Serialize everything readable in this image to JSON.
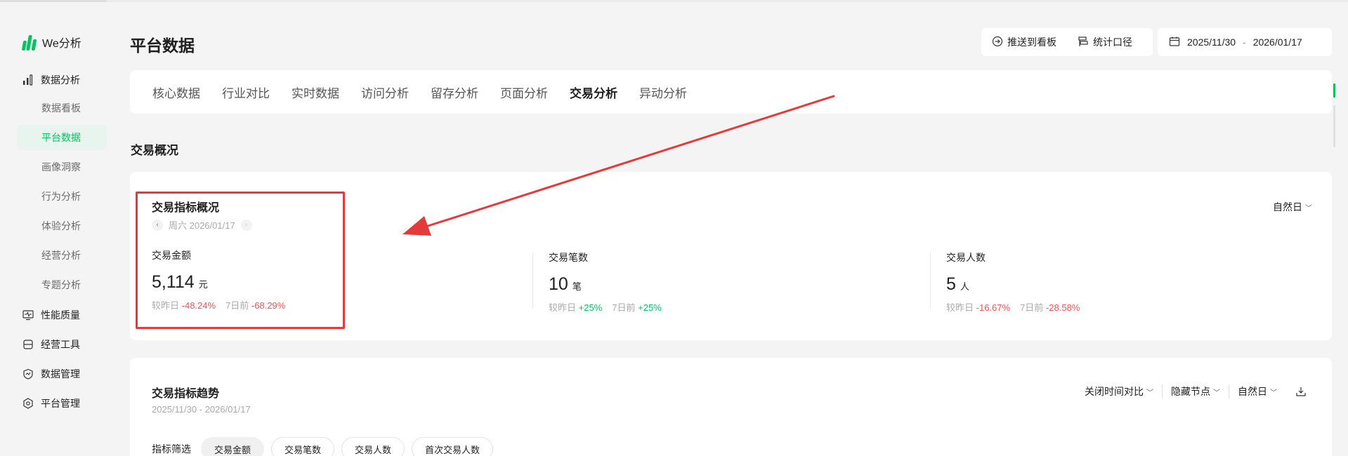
{
  "brand": {
    "name": "We分析",
    "color": "#07c160"
  },
  "sidebar": {
    "groups": [
      {
        "label": "数据分析",
        "icon": "bar-chart-icon"
      },
      {
        "label": "性能质量",
        "icon": "monitor-pulse-icon"
      },
      {
        "label": "经营工具",
        "icon": "toolbox-icon"
      },
      {
        "label": "数据管理",
        "icon": "data-shield-icon"
      },
      {
        "label": "平台管理",
        "icon": "hexagon-gear-icon"
      }
    ],
    "sub_items": [
      {
        "label": "数据看板",
        "active": false
      },
      {
        "label": "平台数据",
        "active": true
      },
      {
        "label": "画像洞察",
        "active": false
      },
      {
        "label": "行为分析",
        "active": false
      },
      {
        "label": "体验分析",
        "active": false
      },
      {
        "label": "经营分析",
        "active": false
      },
      {
        "label": "专题分析",
        "active": false
      }
    ]
  },
  "header": {
    "title": "平台数据",
    "push_label": "推送到看板",
    "metric_caliber_label": "统计口径",
    "date_start": "2025/11/30",
    "date_sep": "-",
    "date_end": "2026/01/17"
  },
  "tabs": [
    {
      "label": "核心数据",
      "active": false
    },
    {
      "label": "行业对比",
      "active": false
    },
    {
      "label": "实时数据",
      "active": false
    },
    {
      "label": "访问分析",
      "active": false
    },
    {
      "label": "留存分析",
      "active": false
    },
    {
      "label": "页面分析",
      "active": false
    },
    {
      "label": "交易分析",
      "active": true
    },
    {
      "label": "异动分析",
      "active": false
    }
  ],
  "section_title": "交易概况",
  "overview": {
    "title": "交易指标概况",
    "date_label": "周六 2026/01/17",
    "period": "自然日",
    "metrics": [
      {
        "label": "交易金额",
        "value": "5,114",
        "unit": "元",
        "day_label": "较昨日",
        "day_change": "-48.24%",
        "day_trend": "neg",
        "week_label": "7日前",
        "week_change": "-68.29%",
        "week_trend": "neg"
      },
      {
        "label": "交易笔数",
        "value": "10",
        "unit": "笔",
        "day_label": "较昨日",
        "day_change": "+25%",
        "day_trend": "pos",
        "week_label": "7日前",
        "week_change": "+25%",
        "week_trend": "pos"
      },
      {
        "label": "交易人数",
        "value": "5",
        "unit": "人",
        "day_label": "较昨日",
        "day_change": "-16.67%",
        "day_trend": "neg",
        "week_label": "7日前",
        "week_change": "-28.58%",
        "week_trend": "neg"
      }
    ]
  },
  "trend": {
    "title": "交易指标趋势",
    "range": "2025/11/30 - 2026/01/17",
    "controls": [
      "关闭时间对比",
      "隐藏节点",
      "自然日"
    ],
    "filter_label": "指标筛选",
    "chips": [
      {
        "label": "交易金额",
        "active": true
      },
      {
        "label": "交易笔数",
        "active": false
      },
      {
        "label": "交易人数",
        "active": false
      },
      {
        "label": "首次交易人数",
        "active": false
      }
    ]
  },
  "colors": {
    "accent": "#07c160",
    "negative": "#fa5151",
    "annotation": "#e53a3a"
  }
}
